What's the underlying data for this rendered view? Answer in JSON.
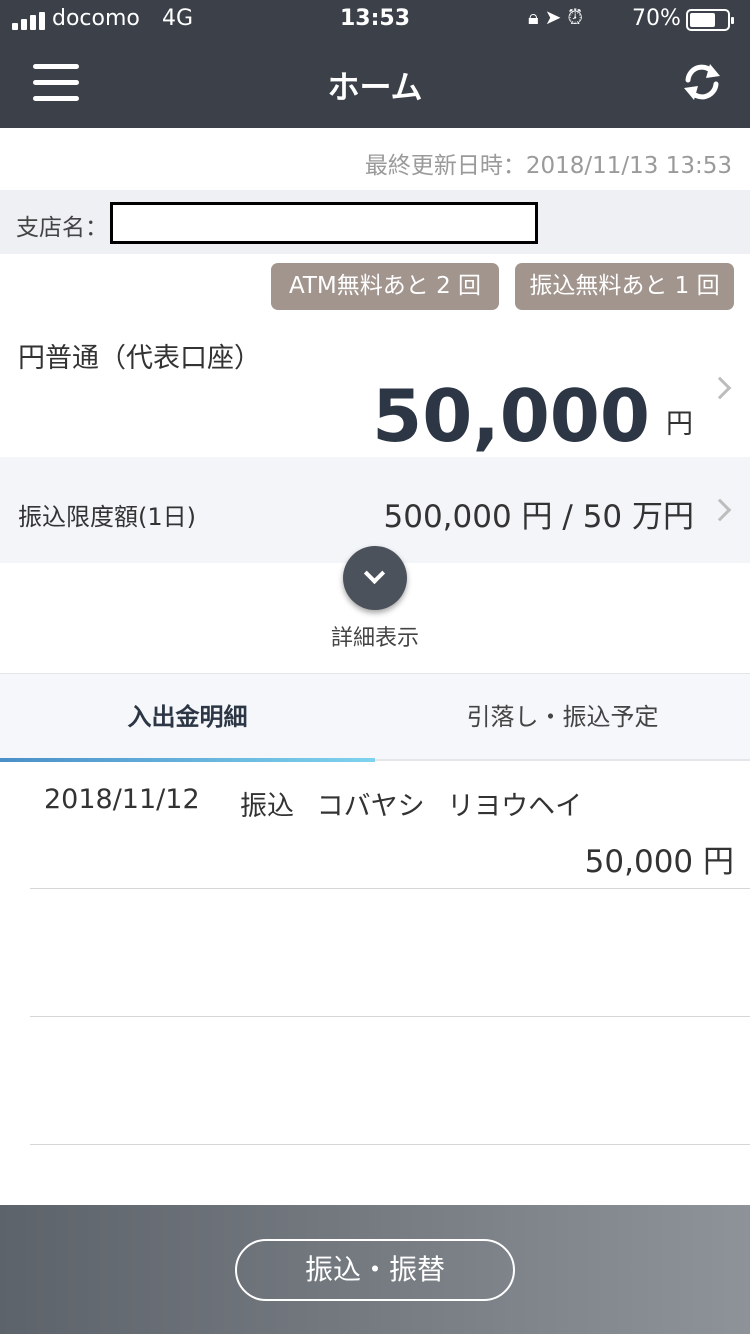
{
  "status_bar": {
    "carrier": "docomo",
    "network": "4G",
    "time": "13:53",
    "battery": "70%",
    "battery_level": 0.7
  },
  "header": {
    "title": "ホーム",
    "menu_icon": "hamburger-menu-icon",
    "refresh_icon": "refresh-icon"
  },
  "last_updated": "最終更新日時：2018/11/13 13:53",
  "branch": {
    "label": "支店名：",
    "value": ""
  },
  "badges": {
    "atm": "ATM無料あと 2 回",
    "transfer": "振込無料あと 1 回"
  },
  "account": {
    "name": "円普通（代表口座）",
    "balance": "50,000",
    "currency": "円"
  },
  "transfer_limit": {
    "label": "振込限度額(1日)",
    "value": "500,000 円 / 50 万円"
  },
  "details": {
    "label": "詳細表示"
  },
  "tabs": [
    {
      "label": "入出金明細",
      "active": true
    },
    {
      "label": "引落し・振込予定",
      "active": false
    }
  ],
  "transactions": [
    {
      "date": "2018/11/12",
      "description": "振込 コバヤシ リヨウヘイ",
      "amount": "50,000 円"
    }
  ],
  "bottom": {
    "transfer_button": "振込・振替"
  },
  "colors": {
    "header_bg": "#3b4049",
    "badge_bg": "#a2958e",
    "balance_text": "#2c3644",
    "tab_underline": "#4a90c8"
  }
}
